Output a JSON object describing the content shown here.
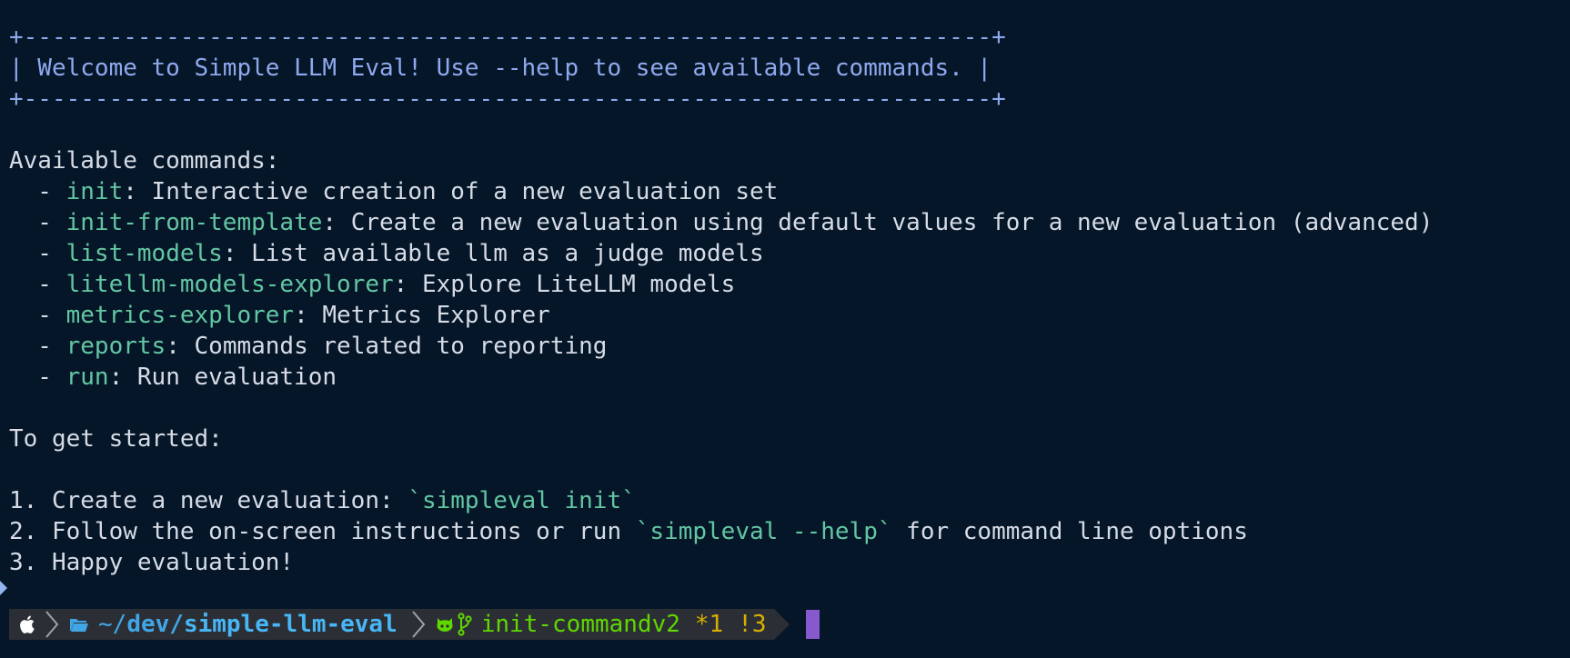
{
  "banner": {
    "border_top": "+--------------------------------------------------------------------+",
    "text": "| Welcome to Simple LLM Eval! Use --help to see available commands. |",
    "border_bottom": "+--------------------------------------------------------------------+"
  },
  "commands_heading": "Available commands:",
  "commands": [
    {
      "bullet": "  - ",
      "name": "init",
      "desc": ": Interactive creation of a new evaluation set"
    },
    {
      "bullet": "  - ",
      "name": "init-from-template",
      "desc": ": Create a new evaluation using default values for a new evaluation (advanced)"
    },
    {
      "bullet": "  - ",
      "name": "list-models",
      "desc": ": List available llm as a judge models"
    },
    {
      "bullet": "  - ",
      "name": "litellm-models-explorer",
      "desc": ": Explore LiteLLM models"
    },
    {
      "bullet": "  - ",
      "name": "metrics-explorer",
      "desc": ": Metrics Explorer"
    },
    {
      "bullet": "  - ",
      "name": "reports",
      "desc": ": Commands related to reporting"
    },
    {
      "bullet": "  - ",
      "name": "run",
      "desc": ": Run evaluation"
    }
  ],
  "getting_started_heading": "To get started:",
  "steps": {
    "step1_prefix": "1. Create a new evaluation: ",
    "step1_code": "`simpleval init`",
    "step2_prefix": "2. Follow the on-screen instructions or run ",
    "step2_code": "`simpleval --help`",
    "step2_suffix": " for command line options",
    "step3": "3. Happy evaluation!"
  },
  "prompt": {
    "os_icon": "apple-icon",
    "folder_icon": "folder-icon",
    "path_home": "~/",
    "path_dev": "dev/",
    "path_repo": "simple-llm-eval",
    "github_icon": "github-icon",
    "branch_icon": "git-branch-icon",
    "branch": "init-commandv2",
    "staged": "*1",
    "modified": "!3"
  },
  "colors": {
    "background": "#051628",
    "text": "#d6dce6",
    "banner": "#8fa9ee",
    "command": "#63c6a2",
    "path": "#48b6f5",
    "git_green": "#5fd700",
    "git_yellow": "#d7af00",
    "cursor": "#8659cc"
  }
}
